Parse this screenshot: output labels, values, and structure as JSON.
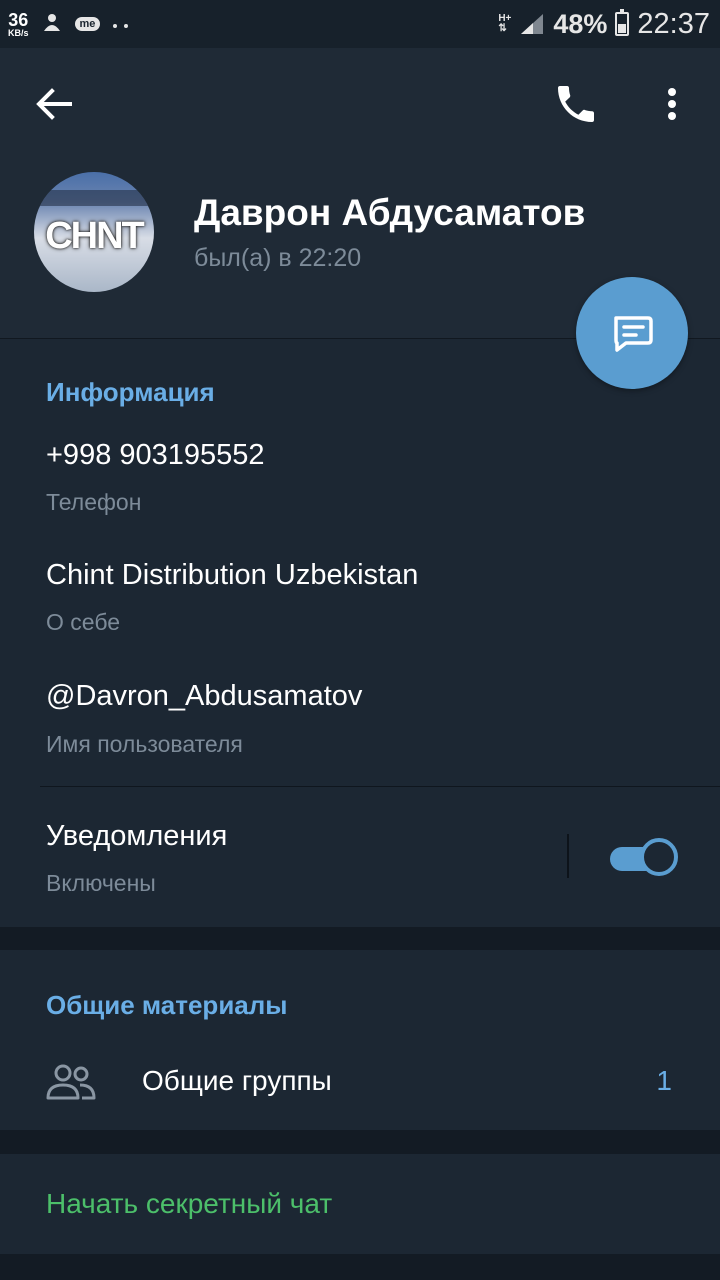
{
  "status_bar": {
    "speed_value": "36",
    "speed_unit": "KB/s",
    "network_type": "H+",
    "battery_percent": "48%",
    "battery_level": 0.48,
    "time": "22:37"
  },
  "header": {
    "contact_name": "Даврон Абдусаматов",
    "last_seen": "был(а) в 22:20",
    "avatar_text": "CHNT"
  },
  "info": {
    "section_title": "Информация",
    "phone_value": "+998 903195552",
    "phone_label": "Телефон",
    "bio_value": "Chint Distribution Uzbekistan",
    "bio_label": "О себе",
    "username_value": "@Davron_Abdusamatov",
    "username_label": "Имя пользователя",
    "notifications_title": "Уведомления",
    "notifications_status": "Включены",
    "notifications_enabled": true
  },
  "media": {
    "section_title": "Общие материалы",
    "groups_label": "Общие группы",
    "groups_count": "1"
  },
  "secret": {
    "label": "Начать секретный чат"
  },
  "colors": {
    "accent": "#6aaee6",
    "fab": "#5a9dd0",
    "green": "#4cbf6a",
    "header_bg": "#1f2a36",
    "section_bg": "#1c2733"
  }
}
